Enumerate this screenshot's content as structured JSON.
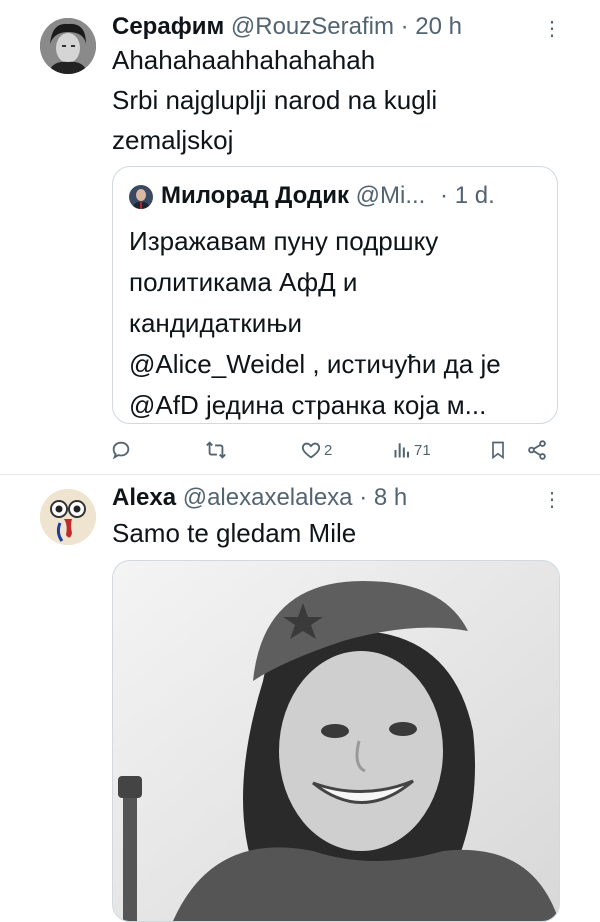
{
  "tweet1": {
    "name": "Серафим",
    "handle": "@RouzSerafim",
    "sep": "·",
    "time": "20 h",
    "more": "⋮",
    "lines": [
      "Ahahahaahhahahahah",
      "Srbi najgluplji narod na kugli",
      "zemaljskoj"
    ],
    "quote": {
      "name": "Милорад Додик",
      "handle": "@Mi...",
      "sep": "·",
      "time": "1 d.",
      "lines": [
        "Изражавам пуну подршку",
        "политикама АфД и",
        "кандидаткињи",
        "@Alice_Weidel , истичући да је",
        "@AfD једина странка која м..."
      ]
    },
    "actions": {
      "reply_icon": "reply-icon",
      "retweet_icon": "retweet-icon",
      "like_icon": "heart-icon",
      "like_count": "2",
      "views_icon": "views-icon",
      "views_count": "71",
      "bookmark_icon": "bookmark-icon",
      "share_icon": "share-icon"
    }
  },
  "tweet2": {
    "name": "Alexa",
    "handle": "@alexaxelalexa",
    "sep": "·",
    "time": "8 h",
    "more": "⋮",
    "text": "Samo te gledam Mile"
  },
  "colors": {
    "text": "#0f1419",
    "muted": "#536471",
    "border": "#cfd9de"
  }
}
